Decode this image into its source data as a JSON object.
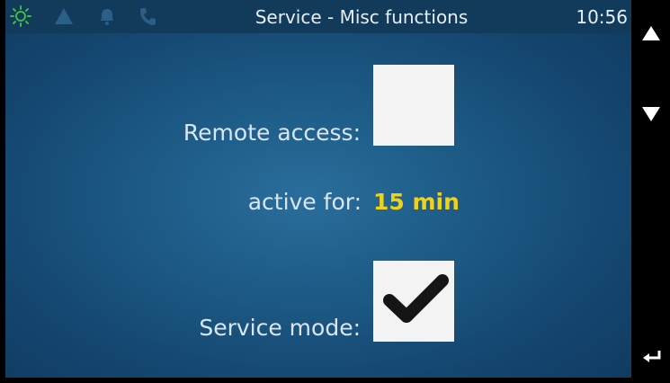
{
  "header": {
    "title": "Service - Misc functions",
    "time": "10:56",
    "status_icons": [
      "sun-icon",
      "warning-icon",
      "bell-icon",
      "phone-icon"
    ]
  },
  "remote_access": {
    "label": "Remote access:",
    "checked": false
  },
  "active_for": {
    "label": "active for:",
    "value": "15 min"
  },
  "service_mode": {
    "label": "Service mode:",
    "checked": true
  },
  "navigation": {
    "icons": [
      "arrow-up-icon",
      "arrow-down-icon",
      "back-icon"
    ]
  },
  "colors": {
    "accent_value": "#f2d216",
    "status_active": "#44b84a",
    "background": "#1d5b86"
  }
}
